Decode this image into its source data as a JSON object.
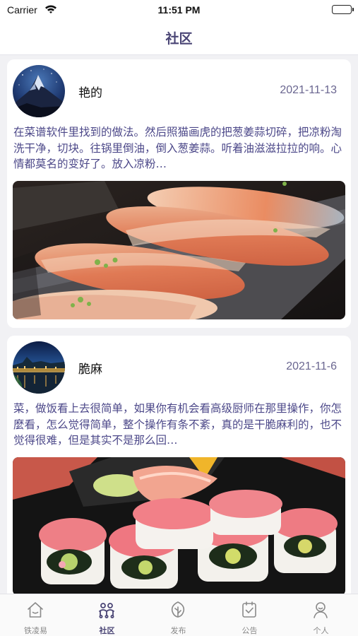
{
  "status_bar": {
    "carrier": "Carrier",
    "time": "11:51 PM"
  },
  "header": {
    "title": "社区"
  },
  "posts": [
    {
      "username": "艳的",
      "date": "2021-11-13",
      "text": "在菜谱软件里找到的做法。然后照猫画虎的把葱姜蒜切碎，把凉粉淘洗干净，切块。往锅里倒油，倒入葱姜蒜。听着油滋滋拉拉的响。心情都莫名的变好了。放入凉粉…"
    },
    {
      "username": "脆麻",
      "date": "2021-11-6",
      "text": "菜，做饭看上去很简单，如果你有机会看高级厨师在那里操作，你怎麼看，怎么觉得简单，整个操作有条不紊，真的是干脆麻利的，也不觉得很难，但是其实不是那么回…"
    }
  ],
  "tabs": [
    {
      "label": "铁凌易",
      "icon": "home-icon",
      "active": false
    },
    {
      "label": "社区",
      "icon": "community-icon",
      "active": true
    },
    {
      "label": "发布",
      "icon": "publish-icon",
      "active": false
    },
    {
      "label": "公告",
      "icon": "announcement-icon",
      "active": false
    },
    {
      "label": "个人",
      "icon": "profile-icon",
      "active": false
    }
  ],
  "colors": {
    "accent": "#4a4575",
    "post_text": "#4c4889",
    "date": "#6a6690",
    "inactive_tab": "#888888"
  }
}
